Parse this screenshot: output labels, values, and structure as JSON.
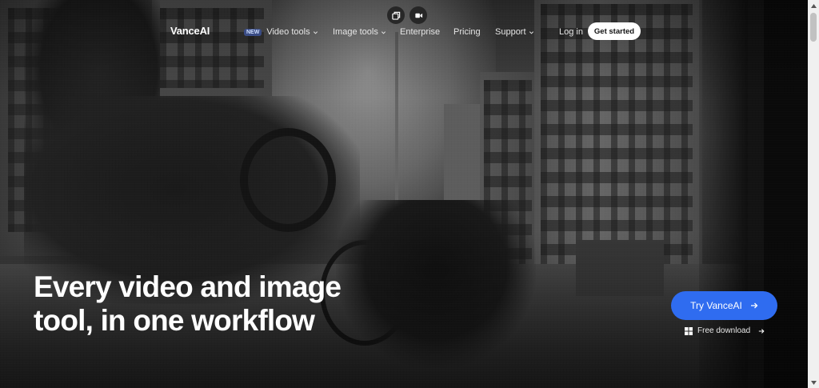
{
  "header": {
    "logo": "VanceAI",
    "nav": [
      {
        "label": "Video tools",
        "badge": "NEW",
        "has_dropdown": true
      },
      {
        "label": "Image tools",
        "has_dropdown": true
      },
      {
        "label": "Enterprise",
        "has_dropdown": false
      },
      {
        "label": "Pricing",
        "has_dropdown": false
      },
      {
        "label": "Support",
        "has_dropdown": true
      }
    ],
    "login": "Log in",
    "get_started": "Get started"
  },
  "media_toggle": {
    "image_icon": "image-gallery-icon",
    "video_icon": "video-play-icon"
  },
  "hero": {
    "headline_line1": "Every video and image",
    "headline_line2": "tool, in one workflow"
  },
  "cta": {
    "try_label": "Try VanceAI",
    "free_download_label": "Free download",
    "try_bg_color": "#2f6cf0",
    "download_icon": "windows-icon"
  }
}
